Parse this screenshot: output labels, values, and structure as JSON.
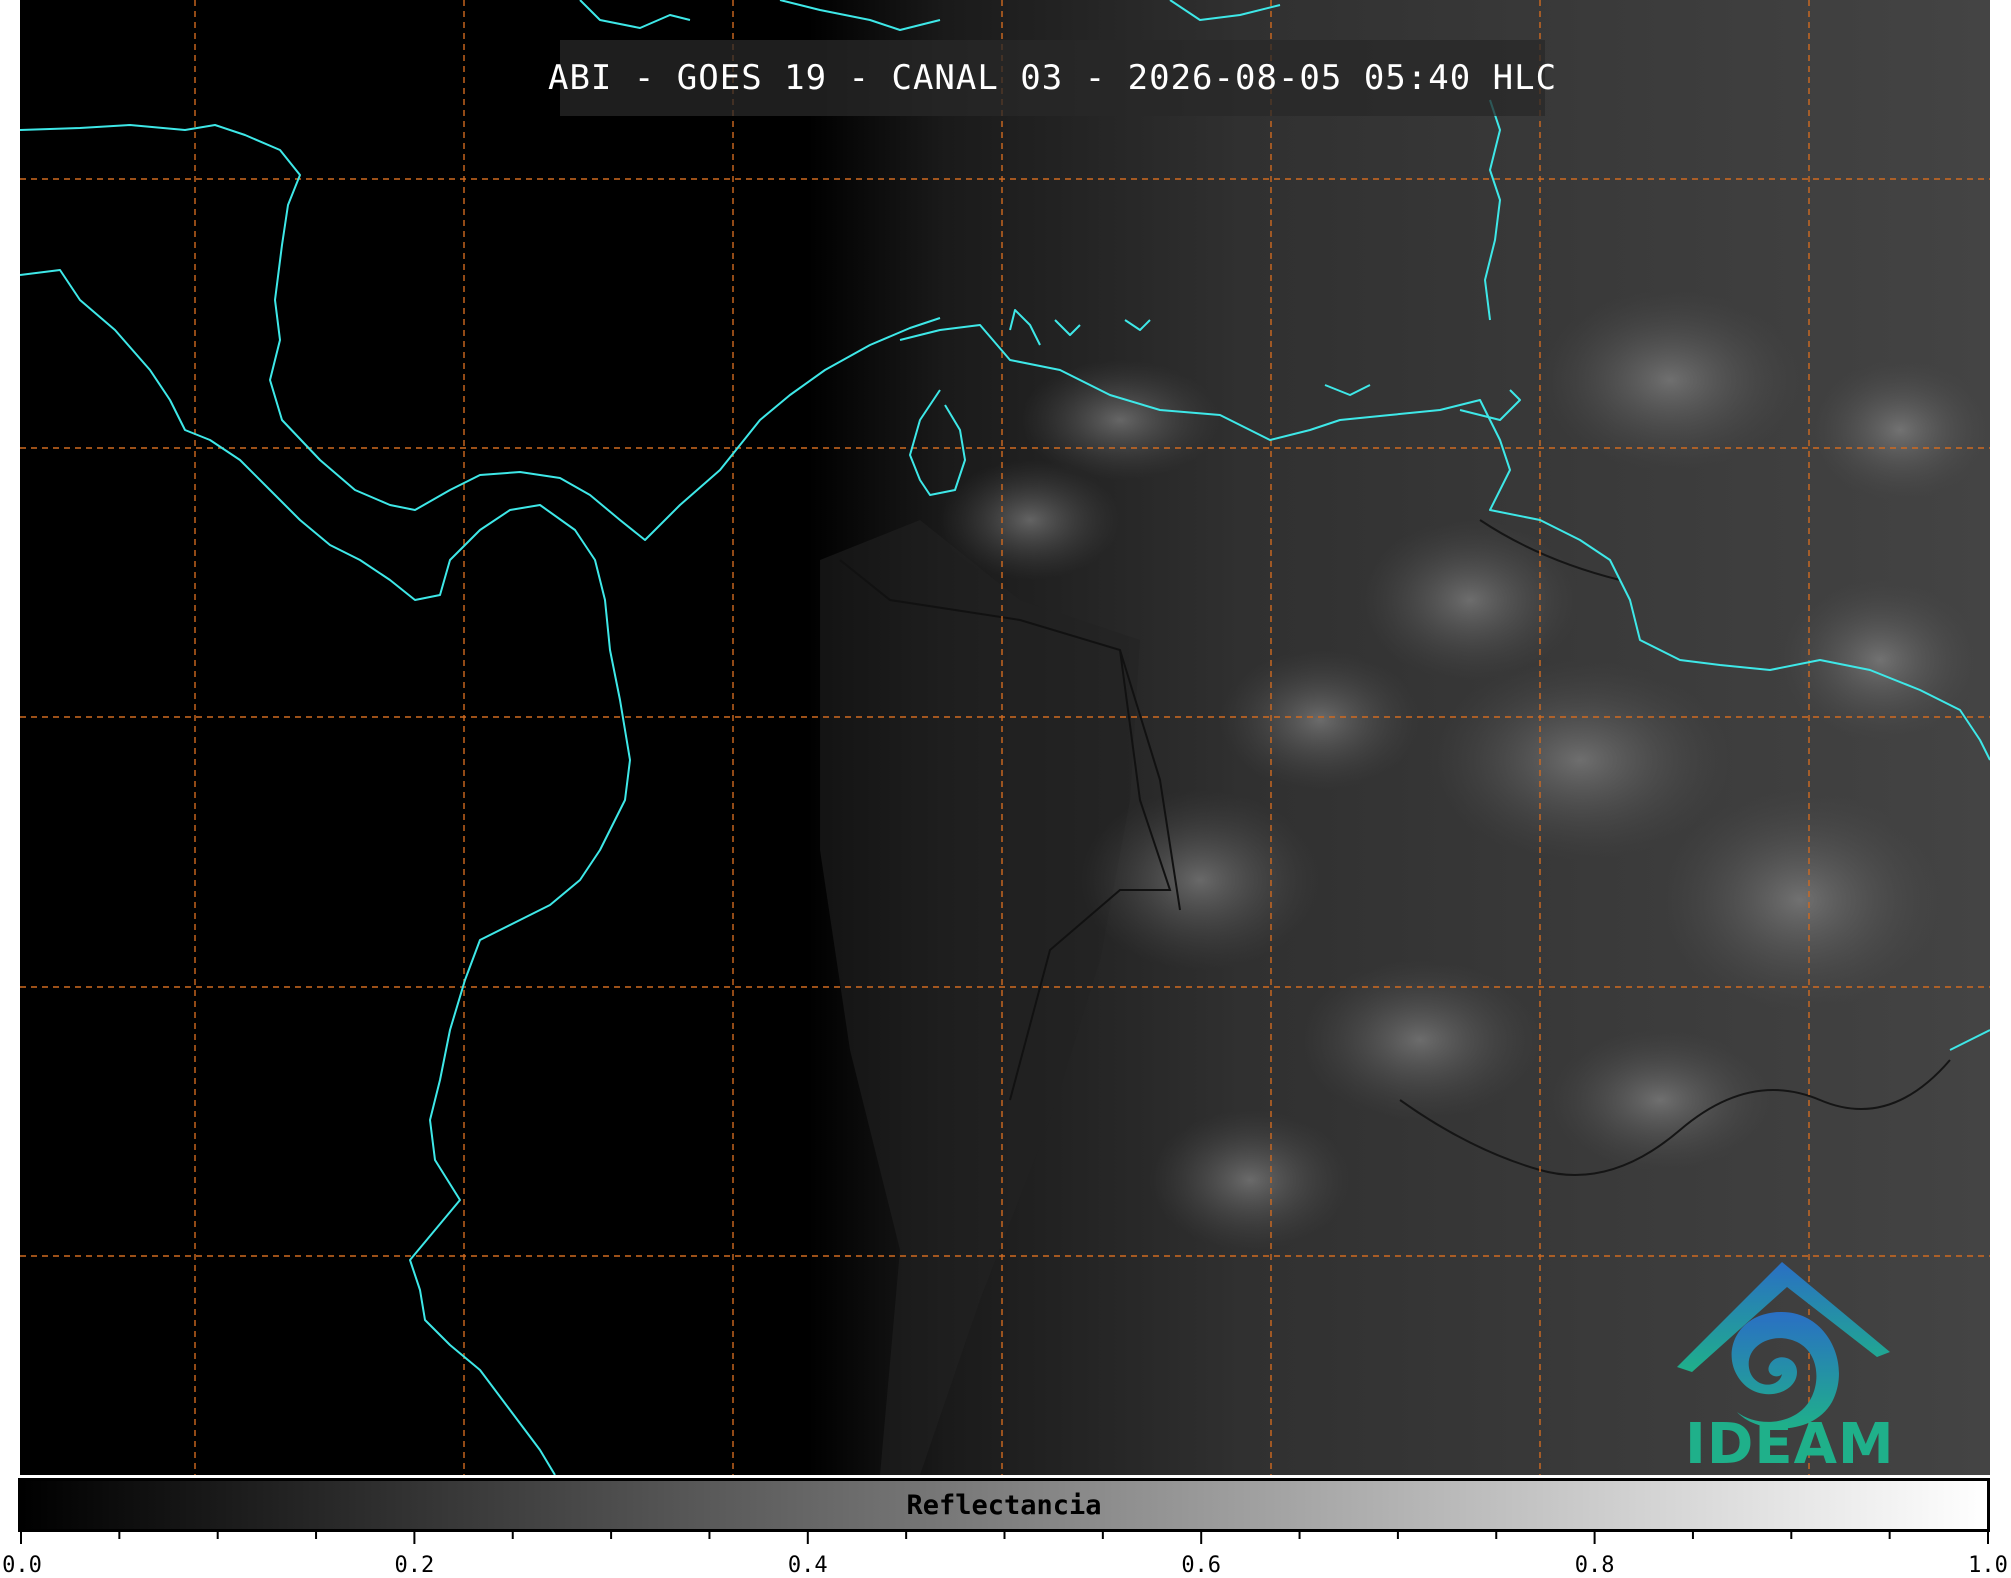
{
  "title": "ABI - GOES 19 - CANAL 03 - 2026-08-05 05:40 HLC",
  "logo": {
    "text": "IDEAM",
    "icon": "ideam-mountain-swirl-logo"
  },
  "colorbar": {
    "label": "Reflectancia",
    "min": 0.0,
    "max": 1.0,
    "tick_labels": [
      "0.0",
      "0.2",
      "0.4",
      "0.6",
      "0.8",
      "1.0"
    ],
    "minor_step": 0.05,
    "colormap": [
      "#000000",
      "#ffffff"
    ]
  },
  "colors": {
    "coastline": "#3ee8e8",
    "graticule": "#d06a20",
    "borders": "#111111"
  }
}
